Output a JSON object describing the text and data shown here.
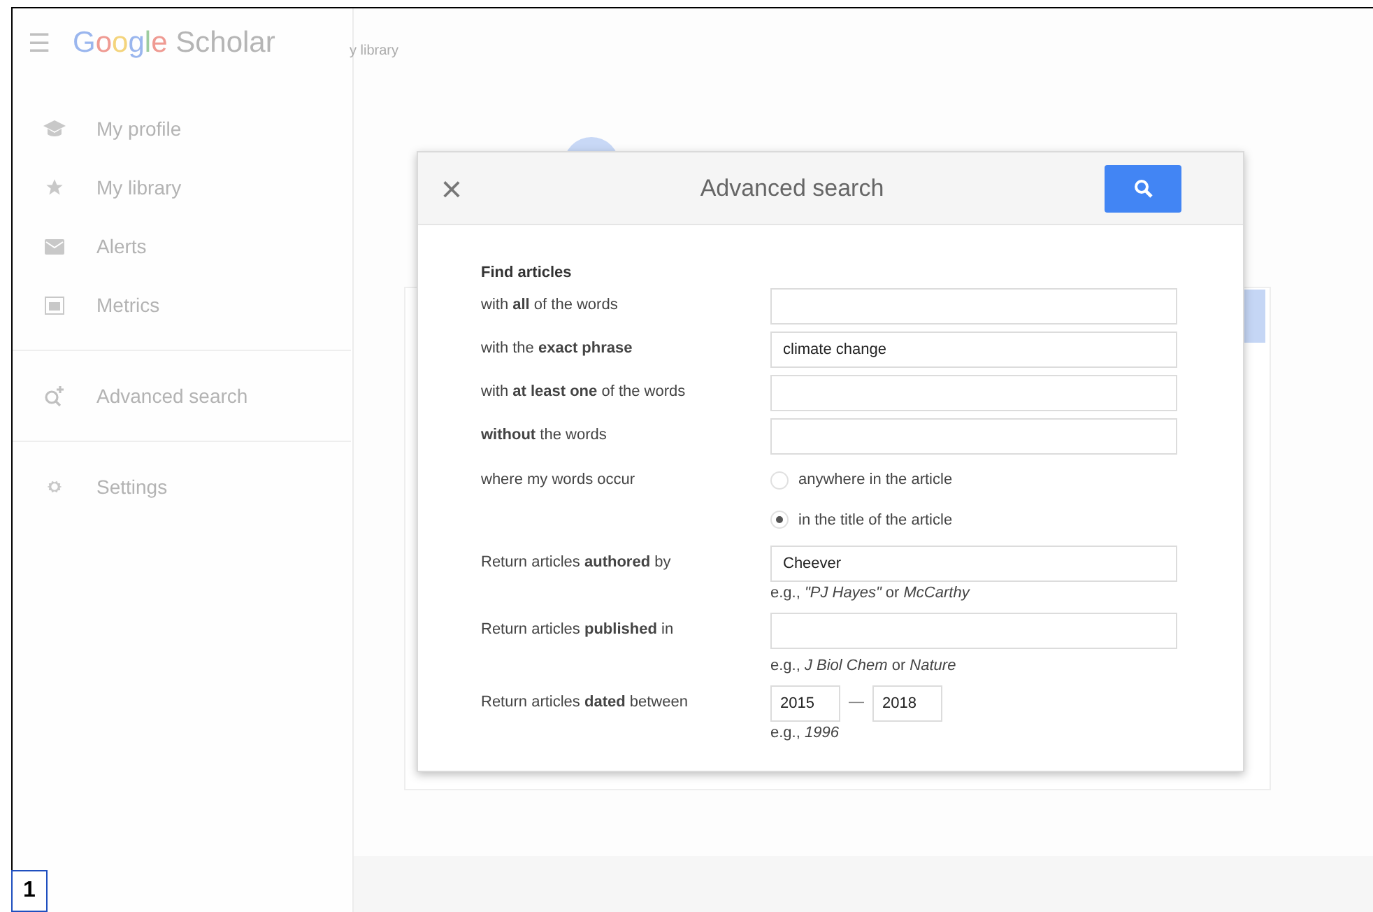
{
  "header": {
    "menu_icon": "☰",
    "logo": "Google Scholar",
    "behind_text": "y library"
  },
  "sidebar": {
    "groups": [
      [
        {
          "label": "My profile"
        },
        {
          "label": "My library"
        },
        {
          "label": "Alerts"
        },
        {
          "label": "Metrics"
        }
      ],
      [
        {
          "label": "Advanced search"
        }
      ],
      [
        {
          "label": "Settings"
        }
      ]
    ]
  },
  "dialog": {
    "close": "×",
    "title": "Advanced search",
    "section": "Find articles",
    "text_rows": [
      {
        "label": "with **all** of the words"
      },
      {
        "label": "with the **exact phrase**",
        "value": "climate change"
      },
      {
        "label": "with **at least one** of the words"
      },
      {
        "label": "**without** the words"
      }
    ],
    "occur": {
      "label": "where my words occur",
      "options": [
        {
          "label": "anywhere in the article",
          "selected": false
        },
        {
          "label": "in the title of the article",
          "selected": true
        }
      ]
    },
    "author": {
      "label": "Return articles **authored** by",
      "value": "Cheever",
      "hint": "e.g., *\"PJ Hayes\"* or *McCarthy*"
    },
    "publication": {
      "label": "Return articles **published** in",
      "hint": "e.g., *J Biol Chem* or *Nature*"
    },
    "dates": {
      "label": "Return articles **dated** between",
      "from": "2015",
      "separator": "—",
      "to": "2018",
      "hint": "e.g., *1996*"
    }
  },
  "figure_number": "1"
}
